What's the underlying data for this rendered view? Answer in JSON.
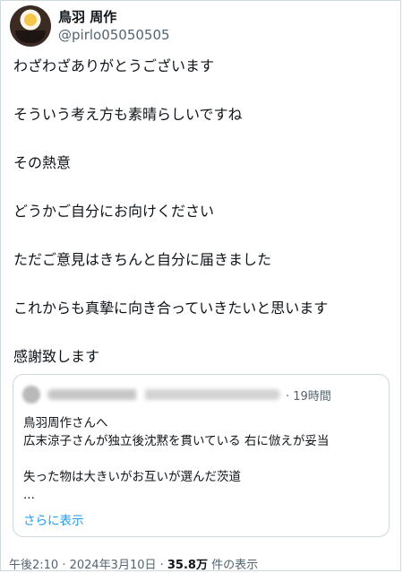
{
  "author": {
    "display_name": "鳥羽 周作",
    "handle": "@pirlo05050505"
  },
  "tweet_lines": [
    "わざわざありがとうございます",
    "そういう考え方も素晴らしいですね",
    "その熱意",
    "どうかご自分にお向けください",
    "ただご意見はきちんと自分に届きました",
    "これからも真摯に向き合っていきたいと思います",
    "感謝致します"
  ],
  "quote": {
    "time": "· 19時間",
    "lines": [
      "鳥羽周作さんへ",
      "広末涼子さんが独立後沈黙を貫いている 右に倣えが妥当",
      "",
      "失った物は大きいがお互いが選んだ茨道",
      "..."
    ],
    "show_more": "さらに表示"
  },
  "meta": {
    "timestamp": "午後2:10 · 2024年3月10日 · ",
    "views_count": "35.8万",
    "views_label": " 件の表示"
  },
  "colors": {
    "text": "#0f1419",
    "secondary": "#536471",
    "link": "#1d9bf0",
    "border": "#cfd9de"
  }
}
